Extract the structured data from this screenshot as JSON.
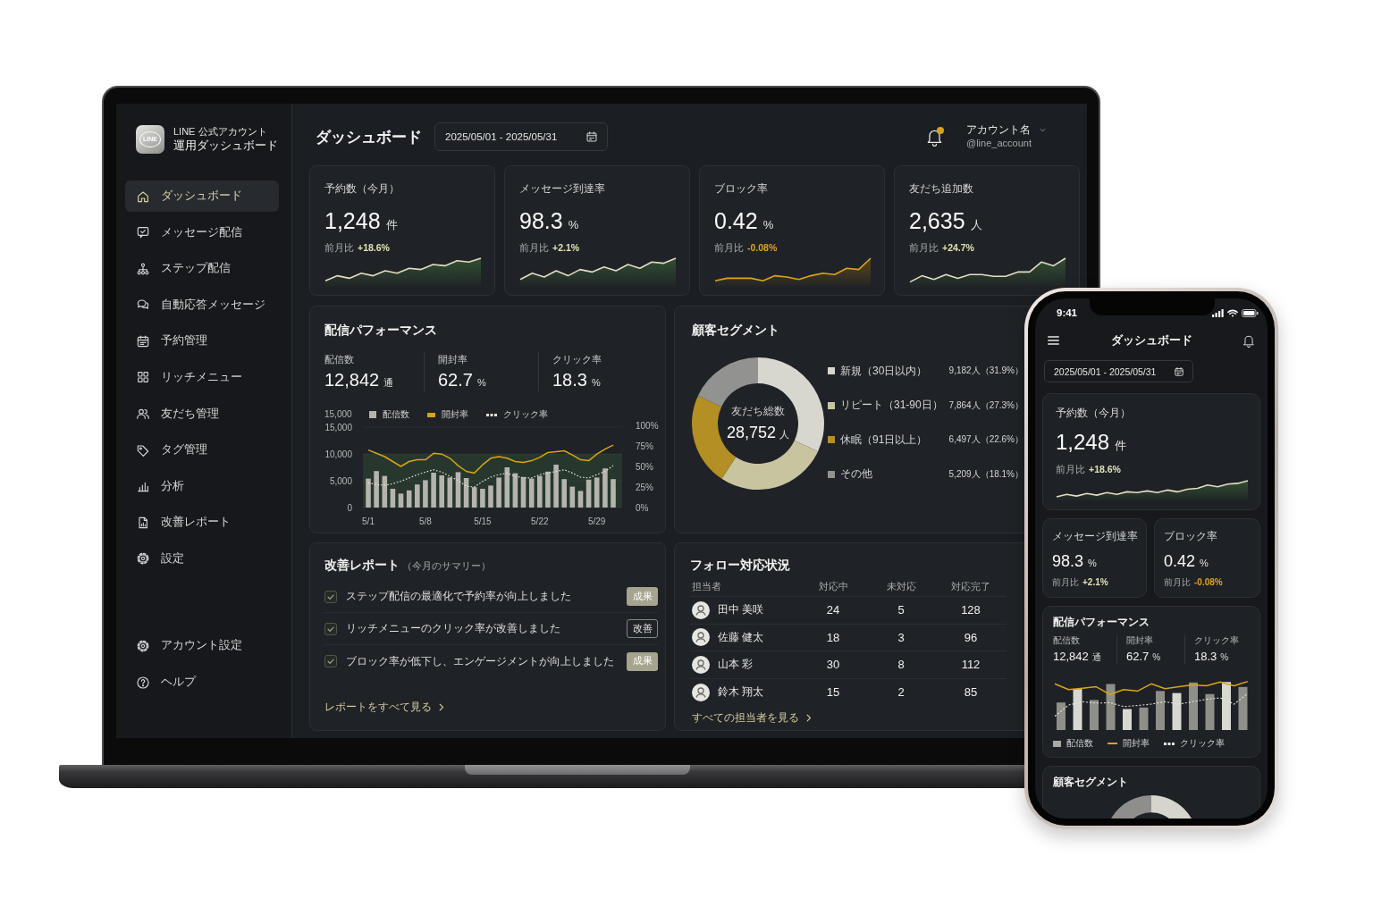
{
  "laptop": {
    "sidebar": {
      "logo": "LINE",
      "brand_line_1": "LINE 公式アカウント",
      "brand_line_2": "運用ダッシュボード",
      "items": [
        {
          "label": "ダッシュボード",
          "selected": true
        },
        {
          "label": "メッセージ配信",
          "selected": false
        },
        {
          "label": "ステップ配信",
          "selected": false
        },
        {
          "label": "自動応答メッセージ",
          "selected": false
        },
        {
          "label": "予約管理",
          "selected": false
        },
        {
          "label": "リッチメニュー",
          "selected": false
        },
        {
          "label": "友だち管理",
          "selected": false
        },
        {
          "label": "タグ管理",
          "selected": false
        },
        {
          "label": "分析",
          "selected": false
        },
        {
          "label": "改善レポート",
          "selected": false
        },
        {
          "label": "設定",
          "selected": false
        }
      ],
      "footer_items": [
        {
          "label": "アカウント設定",
          "selected": false
        },
        {
          "label": "ヘルプ",
          "selected": false
        }
      ]
    },
    "header": {
      "title": "ダッシュボード",
      "date_range": "2025/05/01 - 2025/05/31",
      "notification_unread": true,
      "account_name": "アカウント名",
      "account_handle": "@line_account"
    },
    "kpis": [
      {
        "label": "予約数（今月）",
        "value": "1,248",
        "unit": "件",
        "change_label": "前月比",
        "change": "+18.6%",
        "negative": false
      },
      {
        "label": "メッセージ到達率",
        "value": "98.3",
        "unit": "%",
        "change_label": "前月比",
        "change": "+2.1%",
        "negative": false
      },
      {
        "label": "ブロック率",
        "value": "0.42",
        "unit": "%",
        "change_label": "前月比",
        "change": "-0.08%",
        "negative": true
      },
      {
        "label": "友だち追加数",
        "value": "2,635",
        "unit": "人",
        "change_label": "前月比",
        "change": "+24.7%",
        "negative": false
      }
    ],
    "performance": {
      "title": "配信パフォーマンス",
      "stats": [
        {
          "label": "配信数",
          "value": "12,842",
          "unit": "通"
        },
        {
          "label": "開封率",
          "value": "62.7",
          "unit": "%"
        },
        {
          "label": "クリック率",
          "value": "18.3",
          "unit": "%"
        }
      ],
      "axis_caption": "15,000",
      "chart_data": {
        "type": "bar",
        "legend": "top",
        "categories": [
          "5/1",
          null,
          null,
          null,
          null,
          null,
          null,
          "5/8",
          null,
          null,
          null,
          null,
          null,
          null,
          "5/15",
          null,
          null,
          null,
          null,
          null,
          null,
          "5/22",
          null,
          null,
          null,
          null,
          null,
          null,
          "5/29",
          null,
          null
        ],
        "ylim": [
          0,
          15000
        ],
        "yticks": [
          {
            "value": 0,
            "label": "0"
          },
          {
            "value": 5000,
            "label": "5,000"
          },
          {
            "value": 10000,
            "label": "10,000"
          },
          {
            "value": 15000,
            "label": "15,000"
          }
        ],
        "y2lim": [
          0,
          100
        ],
        "y2ticks": [
          {
            "value": 0,
            "label": "0%"
          },
          {
            "value": 25,
            "label": "25%"
          },
          {
            "value": 50,
            "label": "50%"
          },
          {
            "value": 75,
            "label": "75%"
          },
          {
            "value": 100,
            "label": "100%"
          }
        ],
        "series": [
          {
            "name": "配信数",
            "color": "#b4b4ad",
            "values": [
              5400,
              6800,
              5900,
              3500,
              2600,
              3200,
              4300,
              5100,
              6500,
              6000,
              5600,
              6600,
              5500,
              3800,
              3500,
              4100,
              5600,
              7500,
              6400,
              5700,
              5400,
              5900,
              6700,
              8000,
              5300,
              3900,
              3100,
              5200,
              5600,
              7300,
              5300
            ]
          },
          {
            "name": "開封率",
            "type": "line",
            "axis": "y2",
            "color": "#d9a416",
            "values": [
              70,
              66,
              62,
              56,
              50,
              56,
              58,
              58,
              66,
              65,
              60,
              51,
              44,
              42,
              52,
              60,
              62,
              60,
              56,
              55,
              57,
              61,
              67,
              68,
              69,
              64,
              58,
              57,
              65,
              71,
              76
            ]
          },
          {
            "name": "クリック率",
            "type": "line",
            "axis": "y2",
            "line_style": "dotted",
            "color": "#e4e4de",
            "values": [
              30,
              28,
              27,
              29,
              32,
              36,
              40,
              43,
              46,
              43,
              38,
              33,
              26,
              25,
              32,
              37,
              40,
              42,
              38,
              36,
              36,
              40,
              42,
              44,
              46,
              42,
              37,
              36,
              40,
              44,
              51
            ]
          }
        ]
      }
    },
    "segments": {
      "title": "顧客セグメント",
      "total_label": "友だち総数",
      "total_value": "28,752",
      "total_unit": "人",
      "chart_data": {
        "type": "donut",
        "categories": [
          "新規（30日以内）",
          "リピート（31-90日）",
          "休眠（91日以上）",
          "その他"
        ],
        "values": [
          31.9,
          27.3,
          22.6,
          18.1
        ]
      },
      "legend": [
        {
          "color": "#d8d7cf",
          "reading": "9,182人（31.9%）"
        },
        {
          "color": "#c8c4a0",
          "reading": "7,864人（27.3%）"
        },
        {
          "color": "#b38f24",
          "reading": "6,497人（22.6%）"
        },
        {
          "color": "#929290",
          "reading": "5,209人（18.1%）"
        }
      ]
    },
    "report": {
      "title": "改善レポート",
      "subtitle": "（今月のサマリー）",
      "items": [
        {
          "checked": true,
          "text": "ステップ配信の最適化で予約率が向上しました",
          "tag": "成果",
          "kind": "result"
        },
        {
          "checked": true,
          "text": "リッチメニューのクリック率が改善しました",
          "tag": "改善",
          "kind": "improvement"
        },
        {
          "checked": true,
          "text": "ブロック率が低下し、エンゲージメントが向上しました",
          "tag": "成果",
          "kind": "result"
        }
      ],
      "link": "レポートをすべて見る"
    },
    "follow": {
      "title": "フォロー対応状況",
      "columns": [
        "担当者",
        "対応中",
        "未対応",
        "対応完了"
      ],
      "rows": [
        {
          "cells": [
            "田中 美咲",
            "24",
            "5",
            "128"
          ]
        },
        {
          "cells": [
            "佐藤 健太",
            "18",
            "3",
            "96"
          ]
        },
        {
          "cells": [
            "山本 彩",
            "30",
            "8",
            "112"
          ]
        },
        {
          "cells": [
            "鈴木 翔太",
            "15",
            "2",
            "85"
          ]
        }
      ],
      "link": "すべての担当者を見る"
    }
  },
  "phone": {
    "status_time": "9:41",
    "title": "ダッシュボード",
    "date_range": "2025/05/01 - 2025/05/31",
    "main_kpi": {
      "label": "予約数（今月）",
      "value": "1,248",
      "unit": "件",
      "change_label": "前月比",
      "change": "+18.6%",
      "negative": false
    },
    "kpis": [
      {
        "label": "メッセージ到達率",
        "value": "98.3",
        "unit": "%",
        "change_label": "前月比",
        "change": "+2.1%",
        "negative": false
      },
      {
        "label": "ブロック率",
        "value": "0.42",
        "unit": "%",
        "change_label": "前月比",
        "change": "-0.08%",
        "negative": true
      }
    ],
    "performance": {
      "title": "配信パフォーマンス",
      "stats": [
        {
          "label": "配信数",
          "value": "12,842",
          "unit": "通"
        },
        {
          "label": "開封率",
          "value": "62.7",
          "unit": "%"
        },
        {
          "label": "クリック率",
          "value": "18.3",
          "unit": "%"
        }
      ],
      "legend": [
        {
          "label": "配信数",
          "kind": "bar"
        },
        {
          "label": "開封率",
          "kind": "line"
        },
        {
          "label": "クリック率",
          "kind": "dotted-line"
        }
      ]
    },
    "segments": {
      "title": "顧客セグメント"
    }
  }
}
